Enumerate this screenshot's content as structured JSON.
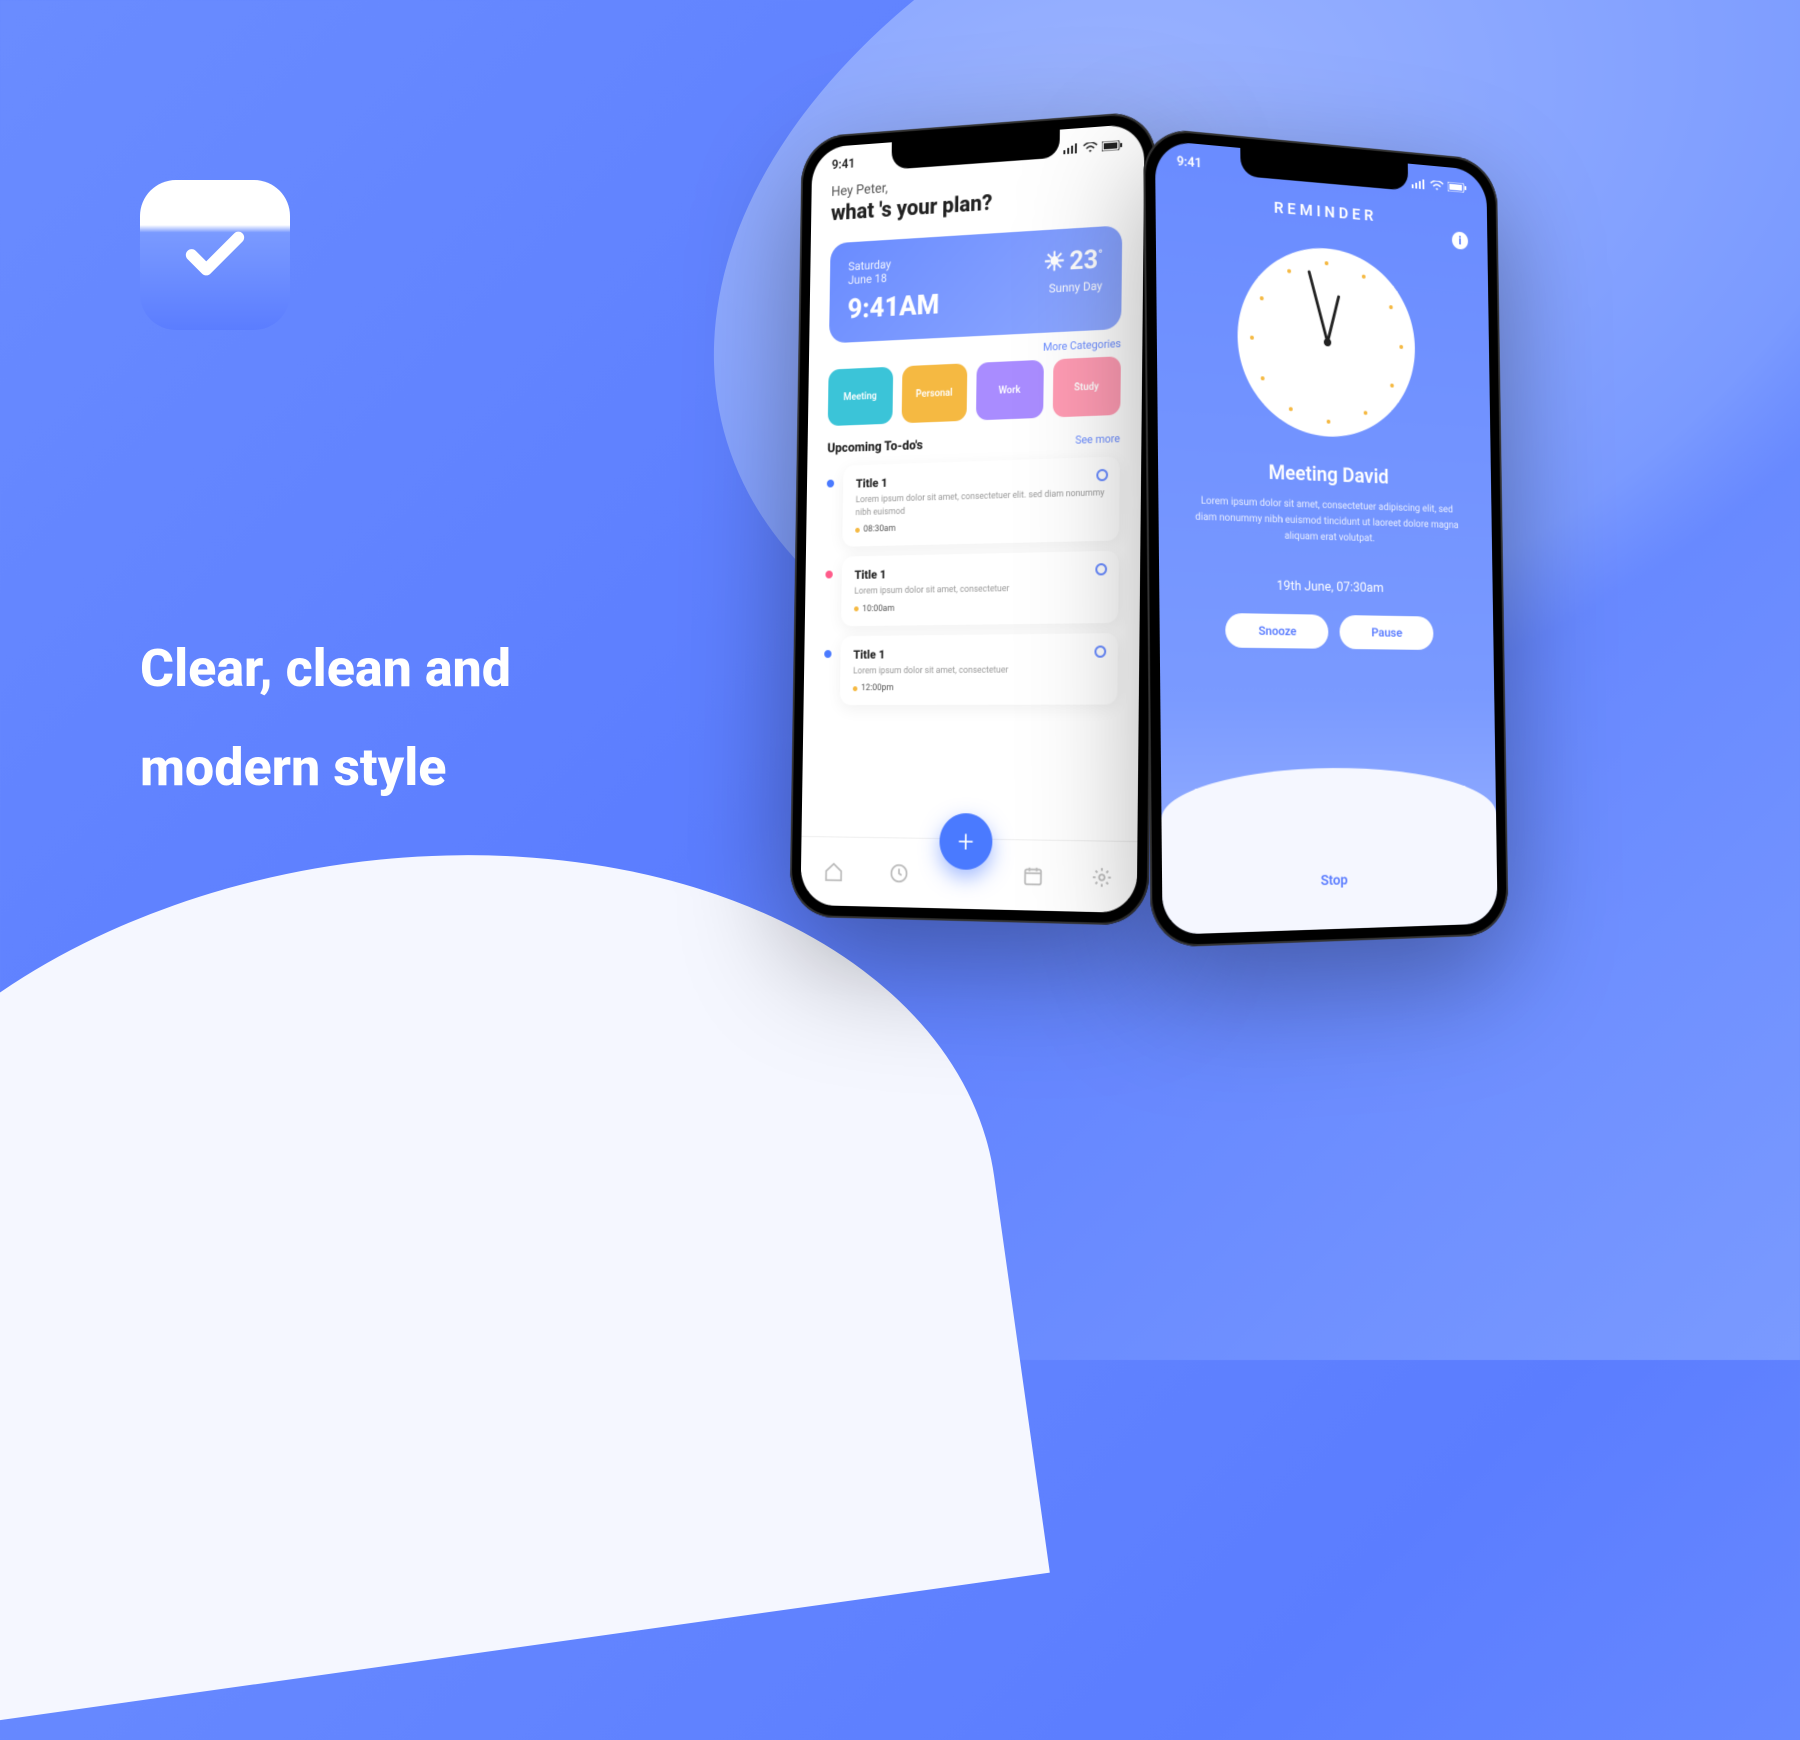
{
  "headline": "Clear, clean and\nmodern style",
  "status_time": "9:41",
  "home": {
    "greeting_small": "Hey Peter,",
    "greeting_big": "what 's your plan?",
    "weather": {
      "day": "Saturday",
      "date": "June 18",
      "time": "9:41AM",
      "temp": "23",
      "desc": "Sunny Day"
    },
    "more_categories": "More Categories",
    "categories": [
      {
        "label": "Meeting"
      },
      {
        "label": "Personal"
      },
      {
        "label": "Work"
      },
      {
        "label": "Study"
      }
    ],
    "upcoming_title": "Upcoming To-do's",
    "see_more": "See more",
    "todos": [
      {
        "title": "Title 1",
        "desc": "Lorem ipsum dolor sit amet, consectetuer elit. sed diam nonummy nibh euismod",
        "time": "08:30am"
      },
      {
        "title": "Title 1",
        "desc": "Lorem ipsum dolor sit amet, consectetuer",
        "time": "10:00am"
      },
      {
        "title": "Title 1",
        "desc": "Lorem ipsum dolor sit amet, consectetuer",
        "time": "12:00pm"
      }
    ]
  },
  "reminder": {
    "title": "REMINDER",
    "event": "Meeting David",
    "desc": "Lorem ipsum dolor sit amet, consectetuer adipiscing elit, sed diam nonummy nibh euismod tincidunt ut laoreet dolore magna aliquam erat volutpat.",
    "datetime": "19th June, 07:30am",
    "snooze": "Snooze",
    "pause": "Pause",
    "stop": "Stop"
  }
}
